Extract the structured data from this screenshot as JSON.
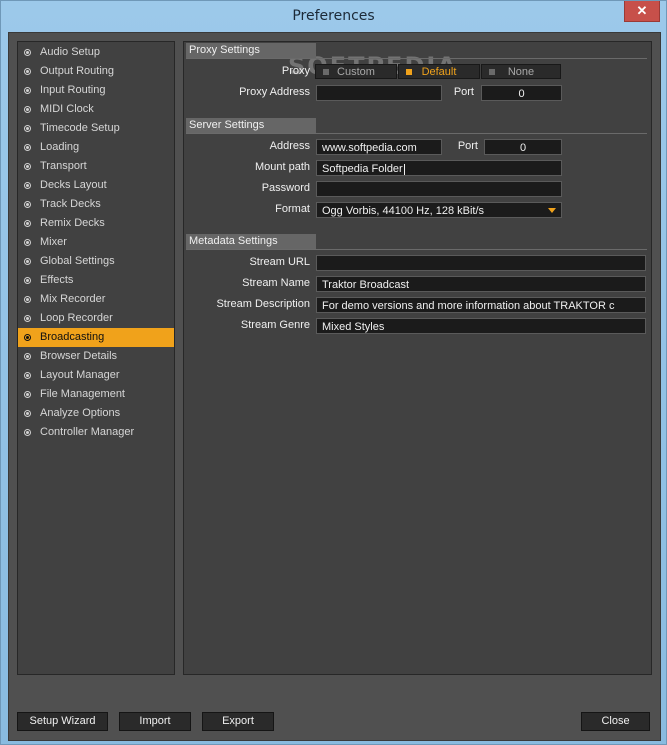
{
  "window": {
    "title": "Preferences",
    "close_glyph": "✕"
  },
  "sidebar": {
    "items": [
      {
        "label": "Audio Setup"
      },
      {
        "label": "Output Routing"
      },
      {
        "label": "Input Routing"
      },
      {
        "label": "MIDI Clock"
      },
      {
        "label": "Timecode Setup"
      },
      {
        "label": "Loading"
      },
      {
        "label": "Transport"
      },
      {
        "label": "Decks Layout"
      },
      {
        "label": "Track Decks"
      },
      {
        "label": "Remix Decks"
      },
      {
        "label": "Mixer"
      },
      {
        "label": "Global Settings"
      },
      {
        "label": "Effects"
      },
      {
        "label": "Mix Recorder"
      },
      {
        "label": "Loop Recorder"
      },
      {
        "label": "Broadcasting"
      },
      {
        "label": "Browser Details"
      },
      {
        "label": "Layout Manager"
      },
      {
        "label": "File Management"
      },
      {
        "label": "Analyze Options"
      },
      {
        "label": "Controller Manager"
      }
    ],
    "selected_index": 15
  },
  "watermark": "SOFTPEDIA",
  "proxy": {
    "title": "Proxy Settings",
    "proxy_label": "Proxy",
    "options": {
      "custom": "Custom",
      "default": "Default",
      "none": "None"
    },
    "selected": "Default",
    "address_label": "Proxy Address",
    "address_value": "",
    "port_label": "Port",
    "port_value": "0"
  },
  "server": {
    "title": "Server Settings",
    "address_label": "Address",
    "address_value": "www.softpedia.com",
    "port_label": "Port",
    "port_value": "0",
    "mount_label": "Mount path",
    "mount_value": "Softpedia Folder",
    "password_label": "Password",
    "password_value": "",
    "format_label": "Format",
    "format_value": "Ogg Vorbis, 44100 Hz, 128 kBit/s"
  },
  "metadata": {
    "title": "Metadata Settings",
    "url_label": "Stream URL",
    "url_value": "",
    "name_label": "Stream Name",
    "name_value": "Traktor Broadcast",
    "desc_label": "Stream Description",
    "desc_value": "For demo versions and more information about TRAKTOR c",
    "genre_label": "Stream Genre",
    "genre_value": "Mixed Styles"
  },
  "footer": {
    "setup_wizard": "Setup Wizard",
    "import": "Import",
    "export": "Export",
    "close": "Close"
  },
  "colors": {
    "accent": "#f0a21b",
    "panel": "#414141",
    "field": "#1b1b1b"
  }
}
